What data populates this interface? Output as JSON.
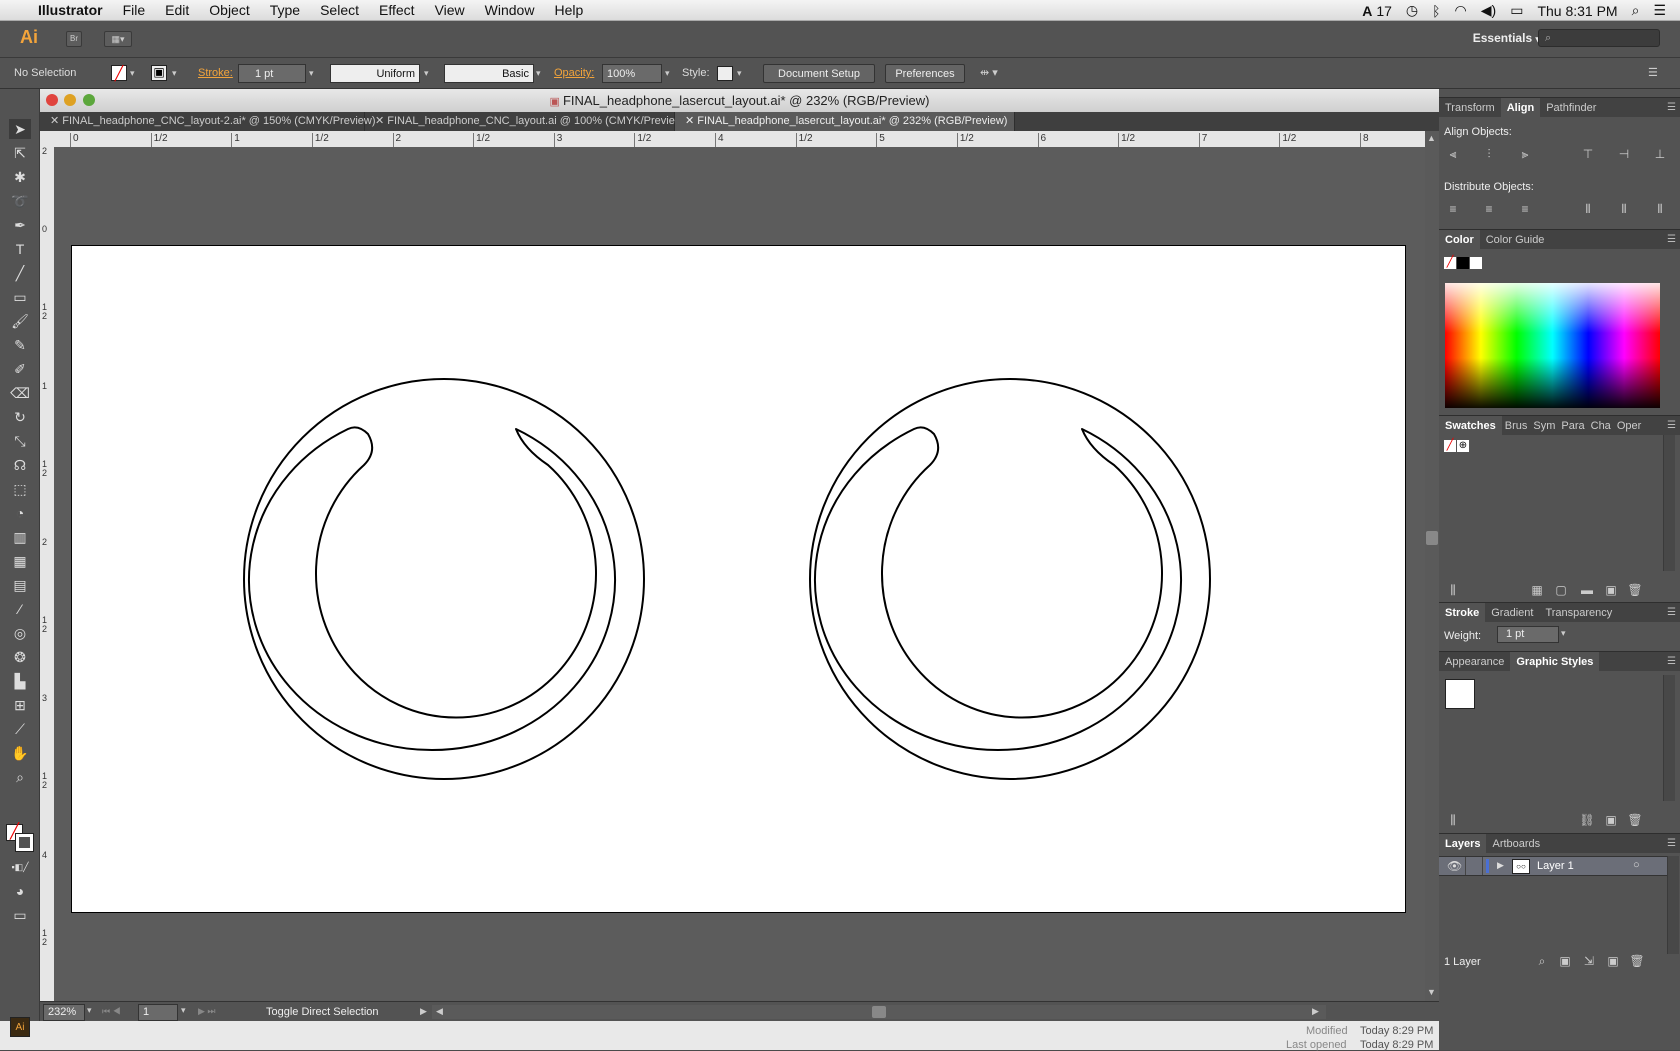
{
  "menubar": {
    "apple": "",
    "app_name": "Illustrator",
    "items": [
      "File",
      "Edit",
      "Object",
      "Type",
      "Select",
      "Effect",
      "View",
      "Window",
      "Help"
    ],
    "status_count": "17",
    "clock": "Thu 8:31 PM"
  },
  "appbar": {
    "logo": "Ai",
    "bridge": "Br",
    "workspace": "Essentials",
    "search_placeholder": "⌕"
  },
  "control": {
    "selection": "No Selection",
    "stroke_label": "Stroke:",
    "stroke_weight": "1 pt",
    "profile": "Uniform",
    "brush": "Basic",
    "opacity_label": "Opacity:",
    "opacity_value": "100%",
    "style_label": "Style:",
    "document_setup": "Document Setup",
    "preferences": "Preferences"
  },
  "document": {
    "title": "FINAL_headphone_lasercut_layout.ai* @ 232% (RGB/Preview)",
    "tabs": [
      {
        "label": "FINAL_headphone_CNC_layout-2.ai* @ 150% (CMYK/Preview)",
        "active": false
      },
      {
        "label": "FINAL_headphone_CNC_layout.ai @ 100% (CMYK/Preview)",
        "active": false
      },
      {
        "label": "FINAL_headphone_lasercut_layout.ai* @ 232% (RGB/Preview)",
        "active": true
      }
    ],
    "hruler_labels": [
      "0",
      "1/2",
      "1",
      "1/2",
      "2",
      "1/2",
      "3",
      "1/2",
      "4",
      "1/2",
      "5",
      "1/2",
      "6",
      "1/2",
      "7",
      "1/2",
      "8"
    ],
    "vruler_labels": [
      "2",
      "0",
      "1 2",
      "1",
      "1 2",
      "2",
      "1 2",
      "3",
      "1 2",
      "4",
      "1 2"
    ]
  },
  "status": {
    "zoom": "232%",
    "artboard": "1",
    "message": "Toggle Direct Selection",
    "modified_label": "Modified",
    "modified_value": "Today 8:29 PM",
    "opened_label": "Last opened",
    "opened_value": "Today 8:29 PM"
  },
  "panels": {
    "align_tabs": [
      "Transform",
      "Align",
      "Pathfinder"
    ],
    "align_objects": "Align Objects:",
    "distribute_objects": "Distribute Objects:",
    "color_tabs": [
      "Color",
      "Color Guide"
    ],
    "swatches_tabs": [
      "Swatches",
      "Brus",
      "Sym",
      "Para",
      "Cha",
      "Oper"
    ],
    "stroke_tabs": [
      "Stroke",
      "Gradient",
      "Transparency"
    ],
    "weight_label": "Weight:",
    "weight_value": "1 pt",
    "appearance_tabs": [
      "Appearance",
      "Graphic Styles"
    ],
    "layers_tabs": [
      "Layers",
      "Artboards"
    ],
    "layer_name": "Layer 1",
    "layer_count": "1 Layer"
  },
  "colors": {
    "accent": "#f3a43b",
    "panel_bg": "#535353",
    "canvas_bg": "#5c5c5c",
    "layer_color": "#4a6fd4"
  }
}
